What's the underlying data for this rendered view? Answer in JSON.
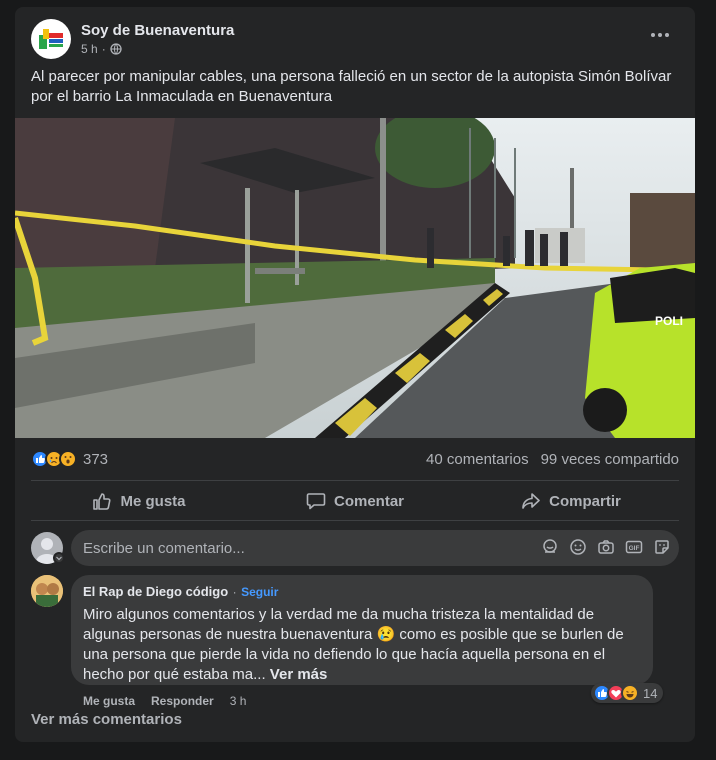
{
  "post": {
    "page_name": "Soy de Buenaventura",
    "time": "5 h",
    "privacy_icon": "globe-icon",
    "text": "Al parecer por manipular cables, una persona falleció en un sector de la autopista Simón Bolívar por el barrio La Inmaculada en Buenaventura",
    "photo_description_icon": "photo",
    "police_label": "POLI"
  },
  "stats": {
    "reaction_icons": [
      "like-icon",
      "sad-icon",
      "wow-icon"
    ],
    "reaction_count": "373",
    "comments": "40 comentarios",
    "shares": "99 veces compartido"
  },
  "actions": {
    "like": "Me gusta",
    "comment": "Comentar",
    "share": "Compartir"
  },
  "comment_input": {
    "placeholder": "Escribe un comentario..."
  },
  "comment": {
    "author": "El Rap de Diego código",
    "separator": "·",
    "follow": "Seguir",
    "text": "Miro algunos comentarios y la verdad me da mucha tristeza la mentalidad de algunas personas de nuestra buenaventura 😢 como es posible que se burlen de una persona que pierde la vida no defiendo lo que hacía aquella persona en el hecho por qué estaba ma...",
    "see_more": "Ver más",
    "like": "Me gusta",
    "reply": "Responder",
    "time": "3 h",
    "reaction_count": "14"
  },
  "view_more_comments": "Ver más comentarios",
  "colors": {
    "background": "#18191a",
    "card": "#242526",
    "input": "#3a3b3c",
    "accent": "#4599ff",
    "like": "#2d88ff",
    "love": "#f33e58",
    "reaction_yellow": "#f7b125",
    "police_green": "#b7e22a"
  }
}
